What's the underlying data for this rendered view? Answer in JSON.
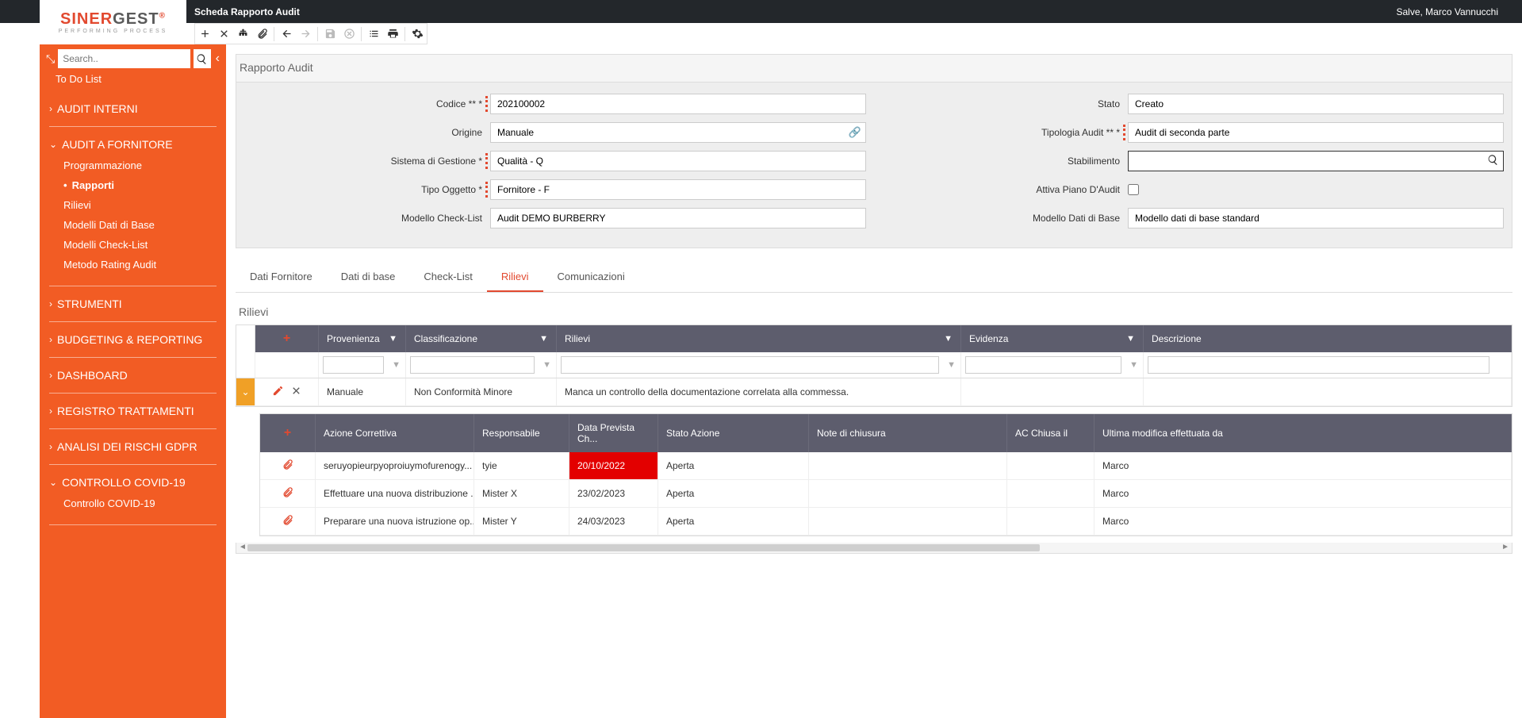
{
  "header": {
    "page_title": "Scheda Rapporto Audit",
    "greeting": "Salve, Marco Vannucchi"
  },
  "logo": {
    "part1": "SINER",
    "part2": "GEST",
    "sub": "PERFORMING PROCESS"
  },
  "sidebar": {
    "search_placeholder": "Search..",
    "top_item": "To Do List",
    "sections": [
      {
        "label": "AUDIT INTERNI",
        "items": []
      },
      {
        "label": "AUDIT A FORNITORE",
        "items": [
          {
            "label": "Programmazione"
          },
          {
            "label": "Rapporti",
            "active": true
          },
          {
            "label": "Rilievi"
          },
          {
            "label": "Modelli Dati di Base"
          },
          {
            "label": "Modelli Check-List"
          },
          {
            "label": "Metodo Rating Audit"
          }
        ]
      },
      {
        "label": "STRUMENTI",
        "items": []
      },
      {
        "label": "BUDGETING & REPORTING",
        "items": []
      },
      {
        "label": "DASHBOARD",
        "items": []
      },
      {
        "label": "REGISTRO TRATTAMENTI",
        "items": []
      },
      {
        "label": "ANALISI DEI RISCHI GDPR",
        "items": []
      },
      {
        "label": "CONTROLLO COVID-19",
        "items": [
          {
            "label": "Controllo COVID-19"
          }
        ]
      }
    ]
  },
  "panel_title": "Rapporto Audit",
  "form": {
    "codice": {
      "label": "Codice ** *",
      "value": "202100002"
    },
    "origine": {
      "label": "Origine",
      "value": "Manuale"
    },
    "sistema": {
      "label": "Sistema di Gestione *",
      "value": "Qualità - Q"
    },
    "tipo_oggetto": {
      "label": "Tipo Oggetto *",
      "value": "Fornitore - F"
    },
    "modello_cl": {
      "label": "Modello Check-List",
      "value": "Audit DEMO BURBERRY"
    },
    "stato": {
      "label": "Stato",
      "value": "Creato"
    },
    "tipologia": {
      "label": "Tipologia Audit ** *",
      "value": "Audit di seconda parte"
    },
    "stabilimento": {
      "label": "Stabilimento",
      "value": ""
    },
    "piano": {
      "label": "Attiva Piano D'Audit"
    },
    "modello_dati": {
      "label": "Modello Dati di Base",
      "value": "Modello dati di base standard"
    }
  },
  "tabs": [
    {
      "label": "Dati Fornitore"
    },
    {
      "label": "Dati di base"
    },
    {
      "label": "Check-List"
    },
    {
      "label": "Rilievi",
      "active": true
    },
    {
      "label": "Comunicazioni"
    }
  ],
  "grid": {
    "title": "Rilievi",
    "headers": {
      "provenienza": "Provenienza",
      "classificazione": "Classificazione",
      "rilievi": "Rilievi",
      "evidenza": "Evidenza",
      "descrizione": "Descrizione"
    },
    "row": {
      "provenienza": "Manuale",
      "classificazione": "Non Conformità Minore",
      "rilievi": "Manca un controllo della documentazione correlata alla commessa.",
      "evidenza": "",
      "descrizione": ""
    }
  },
  "subgrid": {
    "headers": {
      "azione": "Azione Correttiva",
      "responsabile": "Responsabile",
      "data_prevista": "Data Prevista Ch...",
      "stato_azione": "Stato Azione",
      "note": "Note di chiusura",
      "ac_chiusa": "AC Chiusa il",
      "ultima_mod": "Ultima modifica effettuata da"
    },
    "rows": [
      {
        "azione": "seruyopieurpyoproiuymofurenogy...",
        "responsabile": "tyie",
        "data": "20/10/2022",
        "data_red": true,
        "stato": "Aperta",
        "note": "",
        "chiusa": "",
        "ultima": "Marco"
      },
      {
        "azione": "Effettuare una nuova distribuzione ...",
        "responsabile": "Mister X",
        "data": "23/02/2023",
        "data_red": false,
        "stato": "Aperta",
        "note": "",
        "chiusa": "",
        "ultima": "Marco"
      },
      {
        "azione": "Preparare una nuova istruzione op...",
        "responsabile": "Mister Y",
        "data": "24/03/2023",
        "data_red": false,
        "stato": "Aperta",
        "note": "",
        "chiusa": "",
        "ultima": "Marco"
      }
    ]
  }
}
